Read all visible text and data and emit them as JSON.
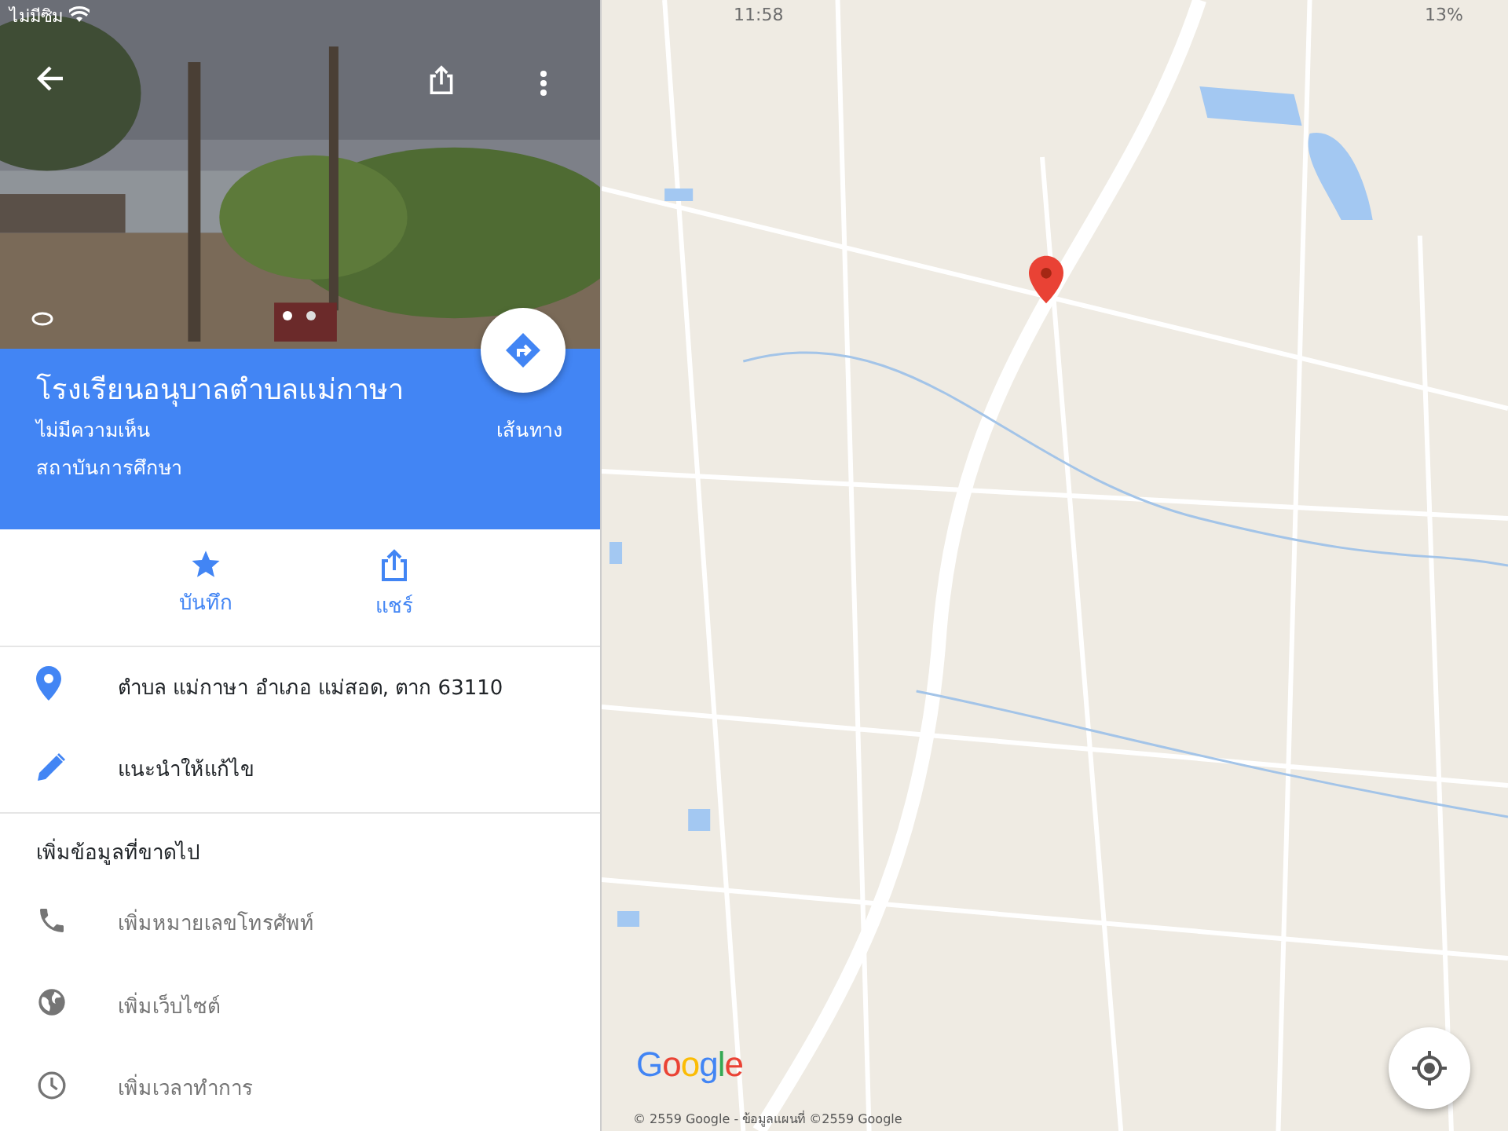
{
  "status_bar": {
    "carrier": "ไม่มีซิม",
    "time": "11:58",
    "battery": "13%"
  },
  "place": {
    "name": "โรงเรียนอนุบาลตำบลแม่กาษา",
    "reviews": "ไม่มีความเห็น",
    "category": "สถาบันการศึกษา",
    "directions_label": "เส้นทาง"
  },
  "actions": [
    {
      "kind": "save",
      "label": "บันทึก"
    },
    {
      "kind": "share",
      "label": "แชร์"
    }
  ],
  "details": [
    {
      "kind": "pin",
      "text": "ตำบล แม่กาษา อำเภอ แม่สอด, ตาก 63110"
    },
    {
      "kind": "edit",
      "text": "แนะนำให้แก้ไข"
    }
  ],
  "missing_info": {
    "title": "เพิ่มข้อมูลที่ขาดไป",
    "items": [
      {
        "kind": "phone",
        "text": "เพิ่มหมายเลขโทรศัพท์"
      },
      {
        "kind": "globe",
        "text": "เพิ่มเว็บไซต์"
      },
      {
        "kind": "clock",
        "text": "เพิ่มเวลาทำการ"
      }
    ]
  },
  "map": {
    "logo": "Google",
    "copyright": "© 2559 Google - ข้อมูลแผนที่ ©2559 Google"
  }
}
